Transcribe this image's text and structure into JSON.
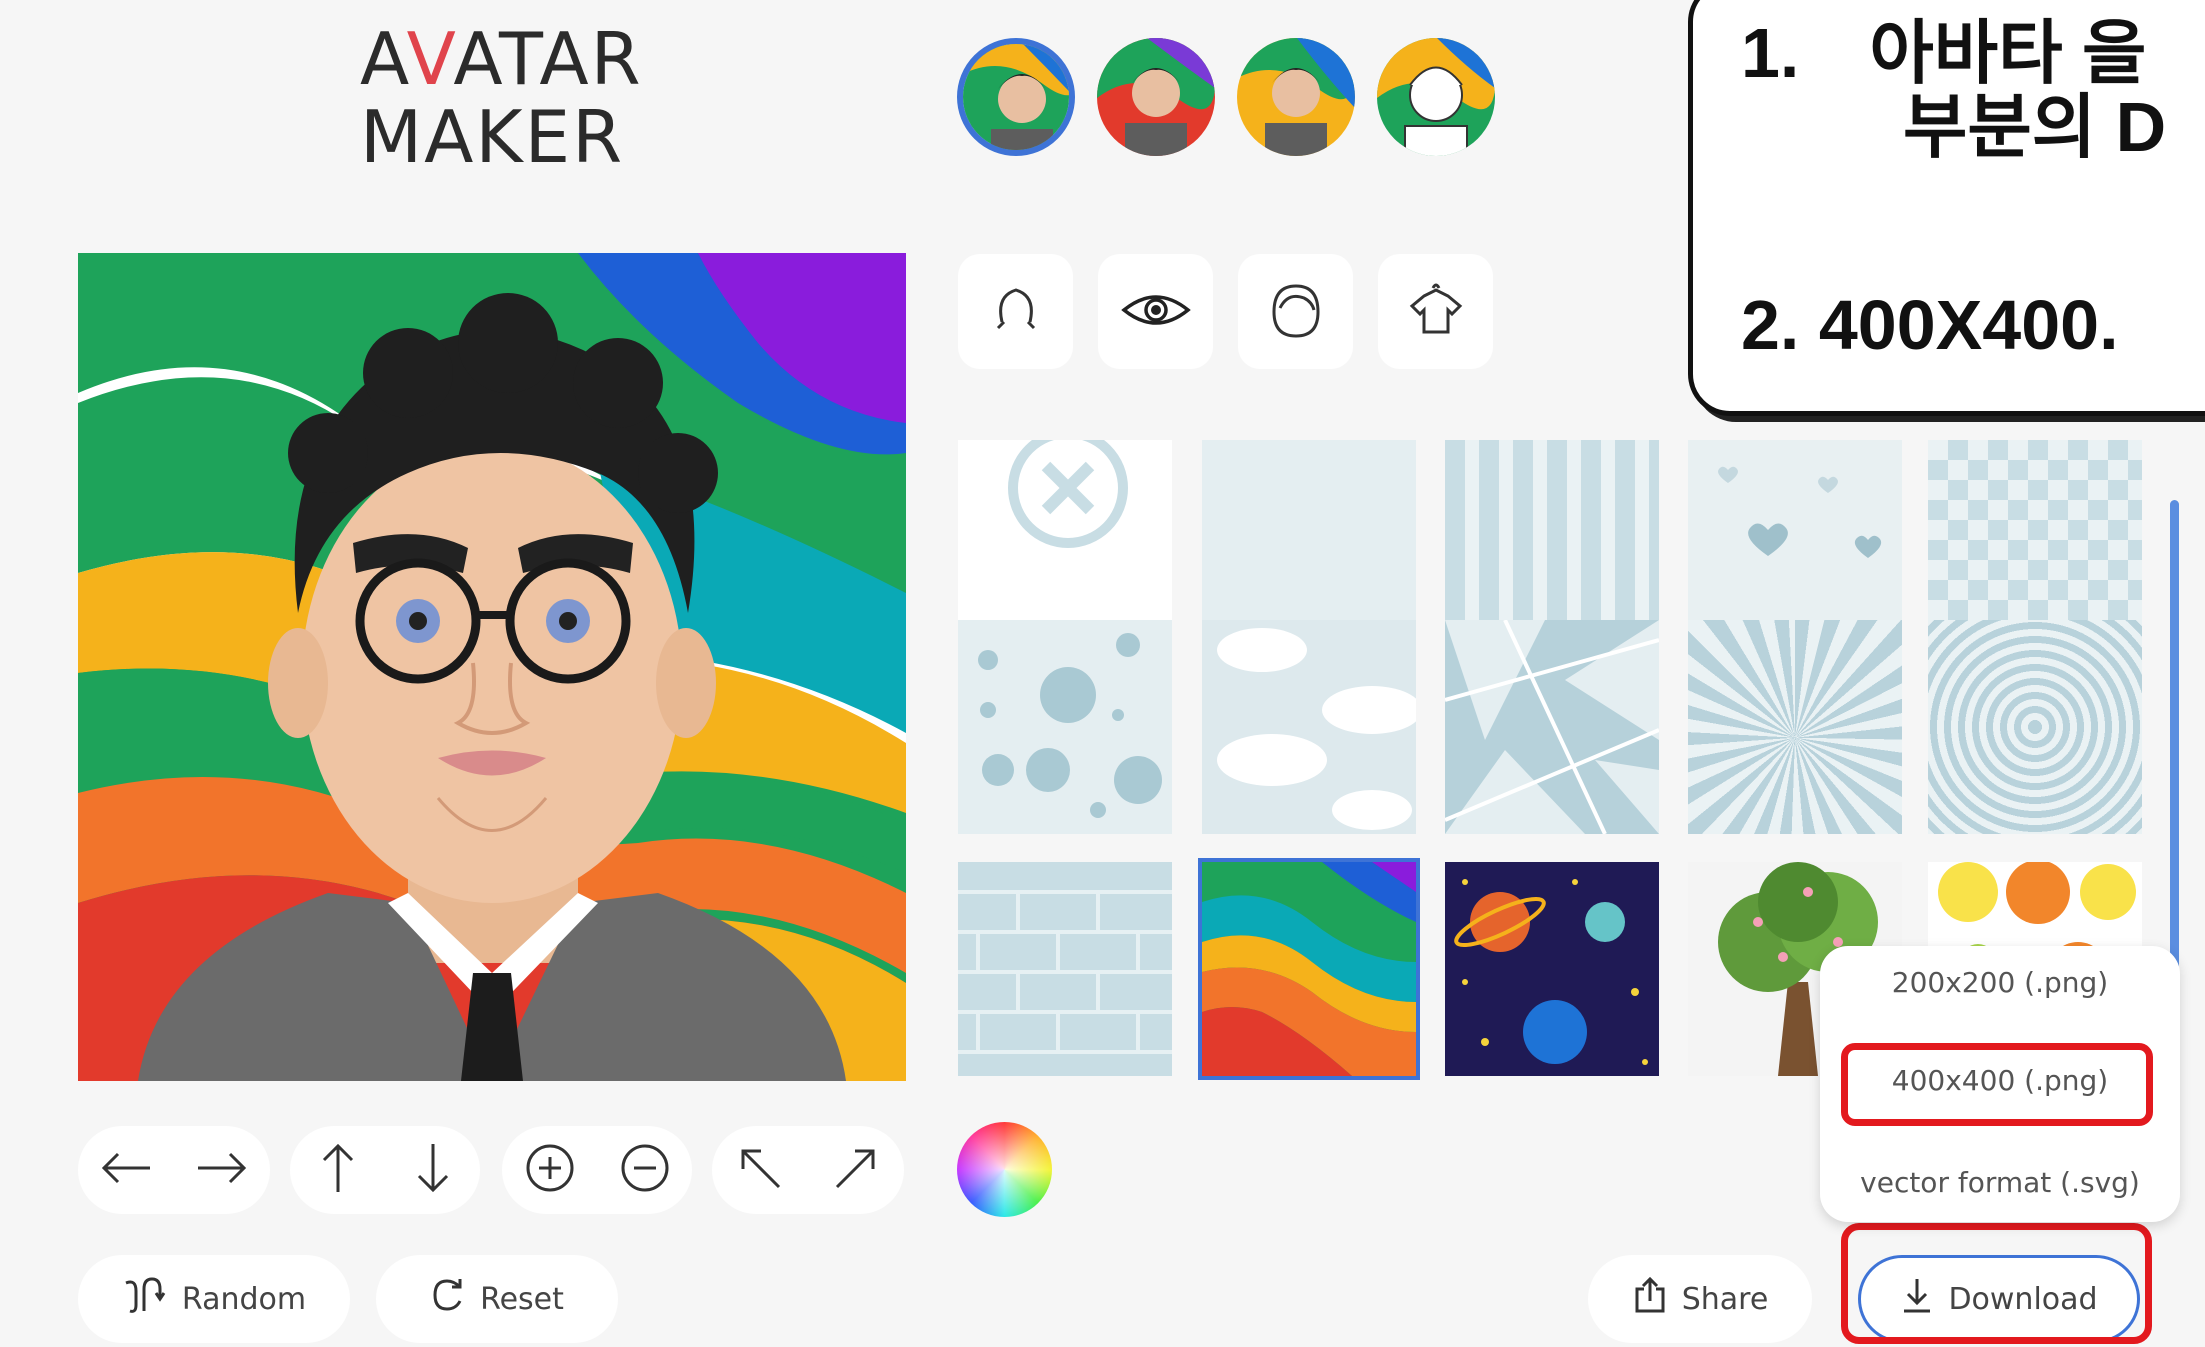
{
  "logo": {
    "line1_a": "A",
    "line1_v": "V",
    "line1_rest": "ATAR",
    "line2": "MAKER"
  },
  "presets": [
    {
      "name": "preset-avatar-color"
    },
    {
      "name": "preset-avatar-color-2"
    },
    {
      "name": "preset-avatar-color-3"
    },
    {
      "name": "preset-avatar-sketch"
    }
  ],
  "tabs": [
    {
      "icon": "face-shape-icon"
    },
    {
      "icon": "eye-icon"
    },
    {
      "icon": "hair-icon"
    },
    {
      "icon": "shirt-icon"
    }
  ],
  "backgrounds": [
    "none",
    "plain",
    "stripes",
    "hearts",
    "checker",
    "dots",
    "clouds",
    "shards",
    "rays",
    "circles",
    "bricks",
    "rainbow-waves",
    "space",
    "tree",
    "citrus"
  ],
  "controls": {
    "random_label": "Random",
    "reset_label": "Reset",
    "share_label": "Share",
    "download_label": "Download"
  },
  "download_menu": {
    "options": [
      "200x200 (.png)",
      "400x400 (.png)",
      "vector format (.svg)"
    ]
  },
  "callout": {
    "line1_num": "1.",
    "line1_text": "아바타 을",
    "line2_text": "부분의 D",
    "line3": "2. 400X400."
  },
  "colors": {
    "accent_blue": "#3e73d6",
    "highlight_red": "#e3191e",
    "tile_blue": "#c8dde4"
  }
}
